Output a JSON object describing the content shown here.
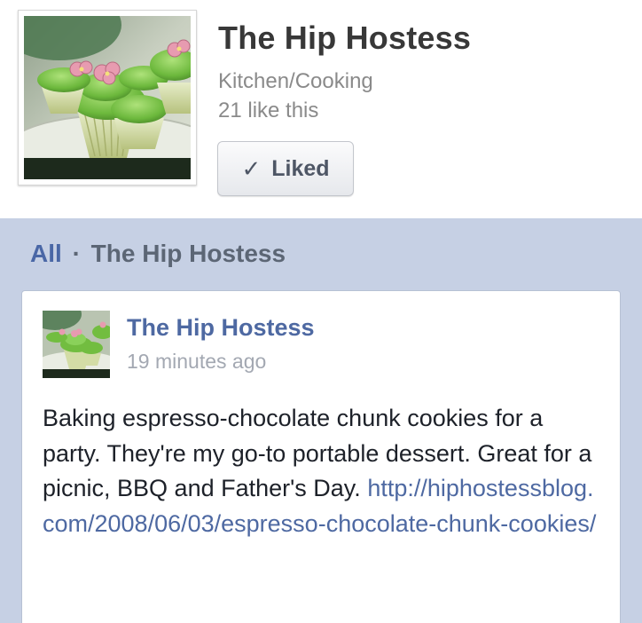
{
  "header": {
    "page_name": "The Hip Hostess",
    "category": "Kitchen/Cooking",
    "likes": "21 like this",
    "liked_button": {
      "icon": "checkmark-icon",
      "icon_glyph": "✓",
      "label": "Liked"
    }
  },
  "feed": {
    "filter_all": "All",
    "filter_separator": "·",
    "filter_page": "The Hip Hostess"
  },
  "post": {
    "author": "The Hip Hostess",
    "time": "19 minutes ago",
    "text": "Baking espresso-chocolate chunk cookies for a party. They're my go-to portable dessert. Great for a picnic, BBQ and Father's Day.",
    "link": "http://hiphostessblog.com/2008/06/03/espresso-chocolate-chunk-cookies/"
  },
  "colors": {
    "feed_background": "#c6d0e4",
    "link_blue": "#4e69a2",
    "title_gray": "#383838",
    "meta_gray": "#8a8a8a"
  }
}
